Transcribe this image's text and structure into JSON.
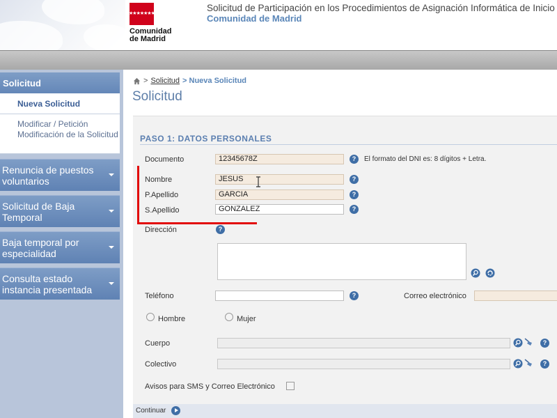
{
  "header": {
    "logo_stars": "★★★★★★★",
    "logo_line1": "Comunidad",
    "logo_line2": "de Madrid",
    "title": "Solicitud de Participación en los Procedimientos de Asignación Informática de Inicio de",
    "subtitle": "Comunidad de Madrid"
  },
  "sidebar": {
    "head": "Solicitud",
    "sub_active": "Nueva Solicitud",
    "sub_normal": "Modificar / Petición Modificación de la Solicitud",
    "groups": [
      "Renuncia de puestos voluntarios",
      "Solicitud de Baja Temporal",
      "Baja temporal por especialidad",
      "Consulta estado instancia presentada"
    ]
  },
  "breadcrumb": {
    "sep": ">",
    "link": "Solicitud",
    "current": "> Nueva Solicitud"
  },
  "page_title": "Solicitud",
  "form": {
    "step_title": "PASO 1: DATOS PERSONALES",
    "documento_label": "Documento",
    "documento_value": "12345678Z",
    "documento_hint": "El formato del DNI es: 8 dígitos + Letra.",
    "nombre_label": "Nombre",
    "nombre_value": "JESUS",
    "apellido1_label": "P.Apellido",
    "apellido1_value": "GARCIA",
    "apellido2_label": "S.Apellido",
    "apellido2_value": "GONZALEZ",
    "direccion_label": "Dirección",
    "telefono_label": "Teléfono",
    "correo_label": "Correo electrónico",
    "hombre_label": "Hombre",
    "mujer_label": "Mujer",
    "cuerpo_label": "Cuerpo",
    "colectivo_label": "Colectivo",
    "avisos_label": "Avisos para SMS y Correo Electrónico",
    "help_glyph": "?",
    "continuar_label": "Continuar"
  },
  "colors": {
    "accent": "#5a86b8",
    "sidebar_group": "#6487b8",
    "annotation": "#e20b0b"
  }
}
